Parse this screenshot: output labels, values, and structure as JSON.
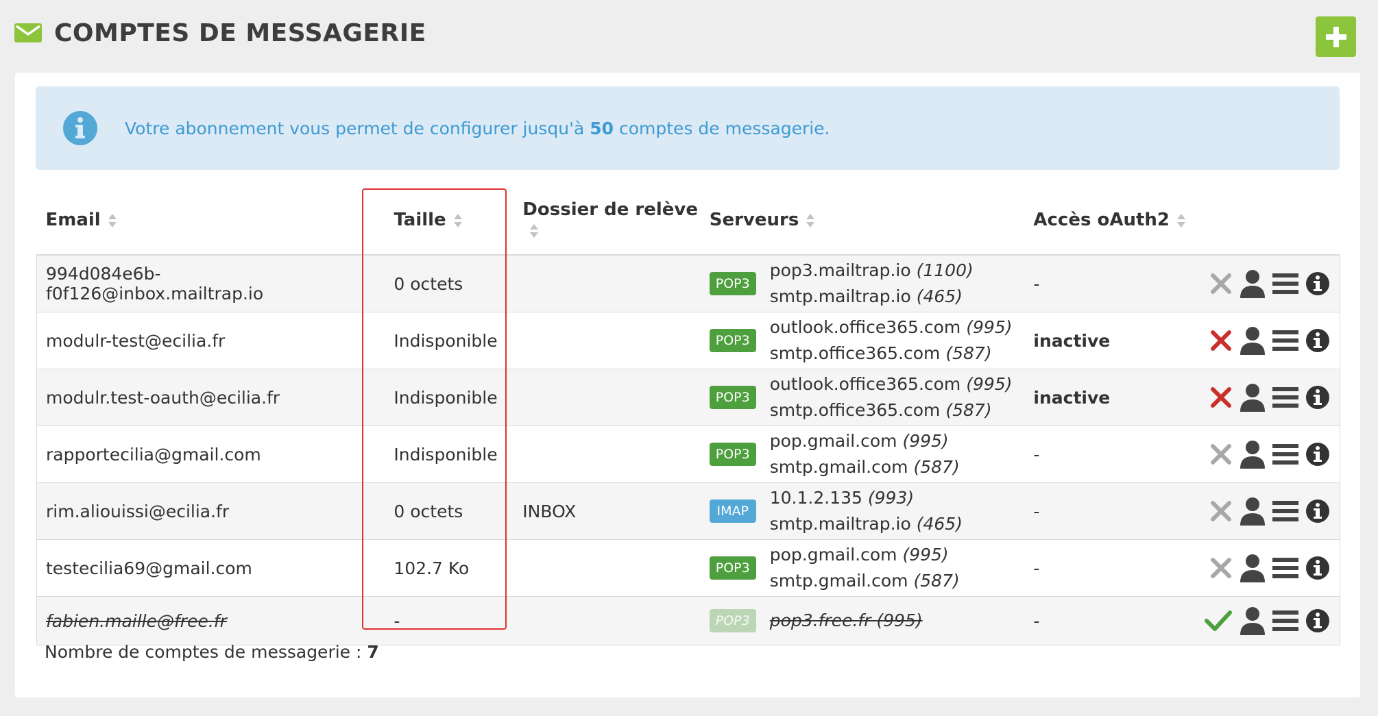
{
  "header": {
    "title": "COMPTES DE MESSAGERIE",
    "icon": "envelope-icon",
    "add_icon": "plus-icon",
    "accent": "#8cc43c"
  },
  "alert": {
    "text_before": "Votre abonnement vous permet de configurer jusqu'à",
    "count": "50",
    "text_after": "comptes de messagerie.",
    "icon": "info-icon",
    "color": "#3f9bd3"
  },
  "columns": {
    "email": "Email",
    "size": "Taille",
    "folder": "Dossier de relève",
    "servers": "Serveurs",
    "oauth": "Accès oAuth2"
  },
  "rows": [
    {
      "email": "994d084e6b-f0f126@inbox.mailtrap.io",
      "size": "0 octets",
      "folder": "",
      "protocol": "POP3",
      "in_host": "pop3.mailtrap.io",
      "in_port": "(1100)",
      "out_host": "smtp.mailtrap.io",
      "out_port": "(465)",
      "oauth": "-",
      "status_icon": "x-gray-icon"
    },
    {
      "email": "modulr-test@ecilia.fr",
      "size": "Indisponible",
      "folder": "",
      "protocol": "POP3",
      "in_host": "outlook.office365.com",
      "in_port": "(995)",
      "out_host": "smtp.office365.com",
      "out_port": "(587)",
      "oauth": "inactive",
      "status_icon": "x-red-icon"
    },
    {
      "email": "modulr.test-oauth@ecilia.fr",
      "size": "Indisponible",
      "folder": "",
      "protocol": "POP3",
      "in_host": "outlook.office365.com",
      "in_port": "(995)",
      "out_host": "smtp.office365.com",
      "out_port": "(587)",
      "oauth": "inactive",
      "status_icon": "x-red-icon"
    },
    {
      "email": "rapportecilia@gmail.com",
      "size": "Indisponible",
      "folder": "",
      "protocol": "POP3",
      "in_host": "pop.gmail.com",
      "in_port": "(995)",
      "out_host": "smtp.gmail.com",
      "out_port": "(587)",
      "oauth": "-",
      "status_icon": "x-gray-icon"
    },
    {
      "email": "rim.aliouissi@ecilia.fr",
      "size": "0 octets",
      "folder": "INBOX",
      "protocol": "IMAP",
      "in_host": "10.1.2.135",
      "in_port": "(993)",
      "out_host": "smtp.mailtrap.io",
      "out_port": "(465)",
      "oauth": "-",
      "status_icon": "x-gray-icon"
    },
    {
      "email": "testecilia69@gmail.com",
      "size": "102.7 Ko",
      "folder": "",
      "protocol": "POP3",
      "in_host": "pop.gmail.com",
      "in_port": "(995)",
      "out_host": "smtp.gmail.com",
      "out_port": "(587)",
      "oauth": "-",
      "status_icon": "x-gray-icon"
    },
    {
      "email": "fabien.maille@free.fr",
      "size": "-",
      "folder": "",
      "protocol": "POP3",
      "in_host": "pop3.free.fr",
      "in_port": "(995)",
      "out_host": "",
      "out_port": "",
      "oauth": "-",
      "status_icon": "check-green-icon"
    }
  ],
  "footer": {
    "label": "Nombre de comptes de messagerie :",
    "count": "7"
  }
}
